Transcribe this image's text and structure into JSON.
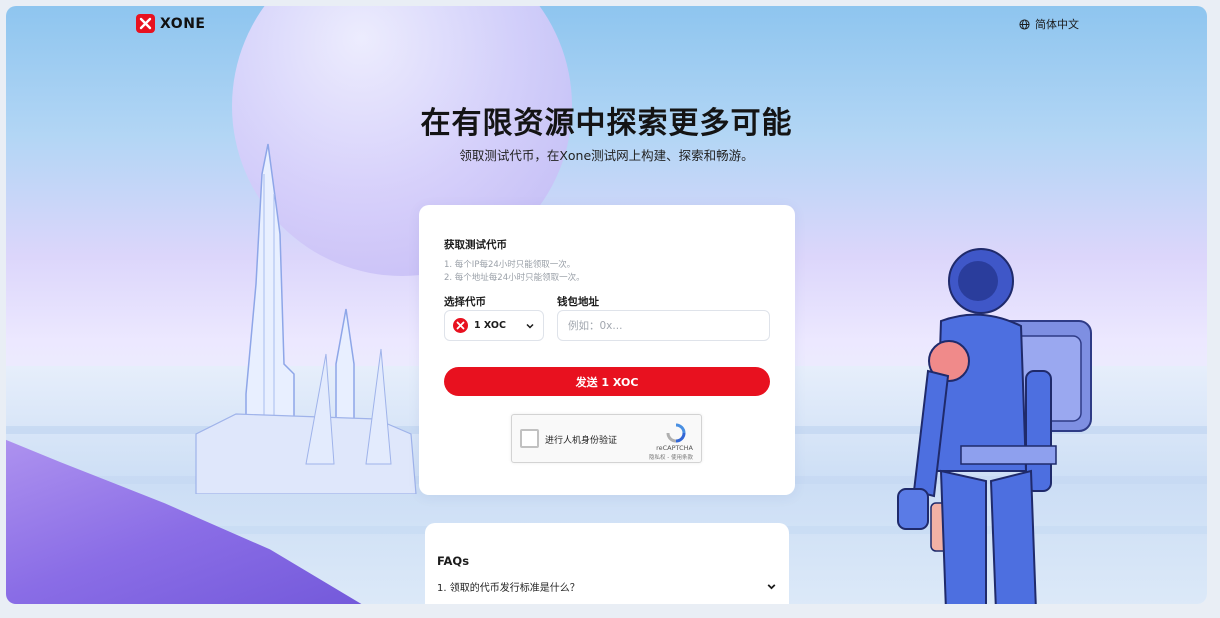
{
  "header": {
    "logo_text": "XONE",
    "language_label": "简体中文"
  },
  "hero": {
    "title": "在有限资源中探索更多可能",
    "subtitle": "领取测试代币，在Xone测试网上构建、探索和畅游。"
  },
  "faucet": {
    "title": "获取测试代币",
    "rules": [
      "1. 每个IP每24小时只能领取一次。",
      "2. 每个地址每24小时只能领取一次。"
    ],
    "token_label": "选择代币",
    "token_value": "1 XOC",
    "wallet_label": "钱包地址",
    "wallet_placeholder": "例如：0x...",
    "wallet_value": "",
    "send_button": "发送 1 XOC",
    "captcha": {
      "label": "进行人机身份验证",
      "brand": "reCAPTCHA",
      "links": "隐私权 - 使用条款"
    }
  },
  "faq": {
    "title": "FAQs",
    "items": [
      {
        "question": "1. 领取的代币发行标准是什么？"
      }
    ]
  },
  "colors": {
    "brand_red": "#e8111f",
    "sky_top": "#8ec5ef",
    "lavender": "#dcd6fb"
  },
  "icons": [
    "xone-logo-icon",
    "globe-icon",
    "chevron-down-icon",
    "recaptcha-icon",
    "xoc-token-icon"
  ]
}
